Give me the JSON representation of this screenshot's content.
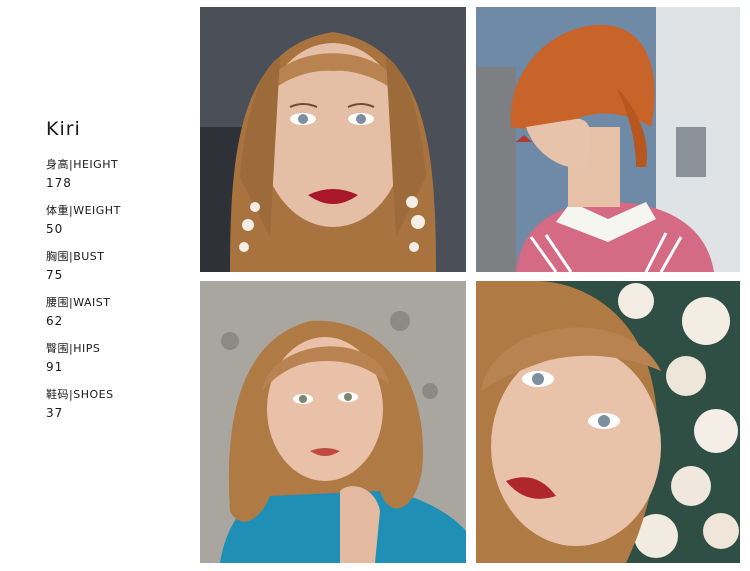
{
  "profile": {
    "name": "Kiri",
    "stats": [
      {
        "label": "身高|HEIGHT",
        "value": "178"
      },
      {
        "label": "体重|WEIGHT",
        "value": "50"
      },
      {
        "label": "胸围|BUST",
        "value": "75"
      },
      {
        "label": "腰围|WAIST",
        "value": "62"
      },
      {
        "label": "臀围|HIPS",
        "value": "91"
      },
      {
        "label": "鞋码|SHOES",
        "value": "37"
      }
    ]
  },
  "photos": [
    {
      "name": "portrait-red-lips-pearl-earrings"
    },
    {
      "name": "portrait-profile-orange-hair"
    },
    {
      "name": "portrait-blue-top"
    },
    {
      "name": "portrait-closeup-flowers"
    }
  ],
  "colors": {
    "text": "#1a1a1a",
    "background": "#ffffff",
    "hair": "#b07a45",
    "hair_orange": "#c8632a",
    "skin": "#e8c1a8",
    "lips": "#a8182a",
    "top_blue": "#1f8fb5"
  }
}
